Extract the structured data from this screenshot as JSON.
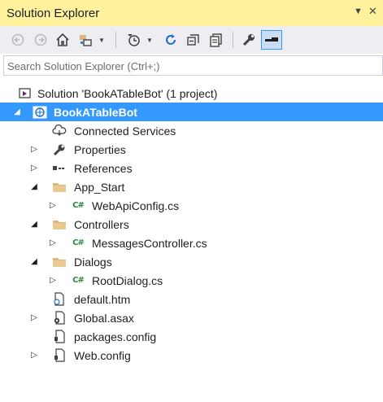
{
  "window": {
    "title": "Solution Explorer",
    "pin_icon": "dropdown-pin-icon",
    "close_icon": "close-icon"
  },
  "toolbar": {
    "icons": [
      "back-icon",
      "forward-icon",
      "home-icon",
      "switch-views-icon",
      "pending-changes-filter-icon",
      "refresh-icon",
      "collapse-all-icon",
      "show-all-files-icon",
      "properties-icon",
      "preview-selected-icon"
    ]
  },
  "search": {
    "placeholder": "Search Solution Explorer (Ctrl+;)"
  },
  "tree": {
    "solution": "Solution 'BookATableBot' (1 project)",
    "project": "BookATableBot",
    "connected_services": "Connected Services",
    "properties": "Properties",
    "references": "References",
    "app_start": "App_Start",
    "webapiconfig": "WebApiConfig.cs",
    "controllers": "Controllers",
    "messagescontroller": "MessagesController.cs",
    "dialogs": "Dialogs",
    "rootdialog": "RootDialog.cs",
    "default_htm": "default.htm",
    "global_asax": "Global.asax",
    "packages_config": "packages.config",
    "web_config": "Web.config"
  },
  "colors": {
    "title_bar": "#fff29d",
    "toolbar_bg": "#eeeef2",
    "selection": "#3399ff",
    "csharp_green": "#2b8a3e",
    "folder": "#dcb67a"
  }
}
